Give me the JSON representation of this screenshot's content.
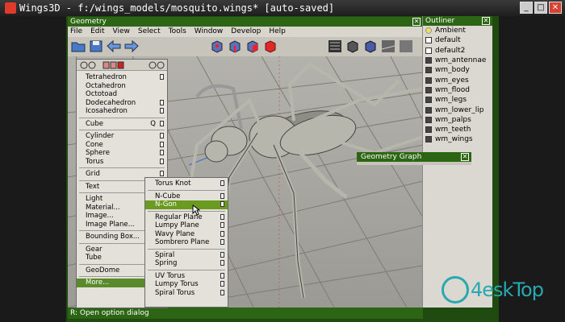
{
  "window": {
    "title": "Wings3D - f:/wings_models/mosquito.wings* [auto-saved]",
    "min": "_",
    "max": "□",
    "close": "✕"
  },
  "geometry": {
    "title": "Geometry",
    "close": "✕"
  },
  "menubar": [
    "File",
    "Edit",
    "View",
    "Select",
    "Tools",
    "Window",
    "Develop",
    "Help"
  ],
  "primitives_menu": {
    "items": [
      {
        "label": "Tetrahedron",
        "opt": true
      },
      {
        "label": "Octahedron",
        "opt": false
      },
      {
        "label": "Octotoad",
        "opt": false
      },
      {
        "label": "Dodecahedron",
        "opt": true
      },
      {
        "label": "Icosahedron",
        "opt": true
      },
      {
        "sep": true
      },
      {
        "label": "Cube",
        "opt": true,
        "key": "Q"
      },
      {
        "sep": true
      },
      {
        "label": "Cylinder",
        "opt": true
      },
      {
        "label": "Cone",
        "opt": true
      },
      {
        "label": "Sphere",
        "opt": true
      },
      {
        "label": "Torus",
        "opt": true
      },
      {
        "sep": true
      },
      {
        "label": "Grid",
        "opt": true
      },
      {
        "sep": true
      },
      {
        "label": "Text",
        "opt": true
      },
      {
        "sep": true
      },
      {
        "label": "Light",
        "opt": false
      },
      {
        "label": "Material...",
        "opt": false
      },
      {
        "label": "Image...",
        "opt": false
      },
      {
        "label": "Image Plane...",
        "opt": false
      },
      {
        "sep": true
      },
      {
        "label": "Bounding Box...",
        "opt": false
      },
      {
        "sep": true
      },
      {
        "label": "Gear",
        "opt": true
      },
      {
        "label": "Tube",
        "opt": true
      },
      {
        "sep": true
      },
      {
        "label": "GeoDome",
        "opt": true
      },
      {
        "sep": true
      },
      {
        "label": "More...",
        "opt": false,
        "hl": true
      }
    ]
  },
  "more_menu": {
    "items": [
      {
        "label": "Torus Knot",
        "opt": true
      },
      {
        "sep": true
      },
      {
        "label": "N-Cube",
        "opt": true
      },
      {
        "label": "N-Gon",
        "opt": true,
        "sel": true
      },
      {
        "sep": true
      },
      {
        "label": "Regular Plane",
        "opt": true
      },
      {
        "label": "Lumpy Plane",
        "opt": true
      },
      {
        "label": "Wavy Plane",
        "opt": true
      },
      {
        "label": "Sombrero Plane",
        "opt": true
      },
      {
        "sep": true
      },
      {
        "label": "Spiral",
        "opt": true
      },
      {
        "label": "Spring",
        "opt": true
      },
      {
        "sep": true
      },
      {
        "label": "UV Torus",
        "opt": true
      },
      {
        "label": "Lumpy Torus",
        "opt": true
      },
      {
        "label": "Spiral Torus",
        "opt": true
      }
    ]
  },
  "outliner": {
    "title": "Outliner",
    "close": "✕",
    "items": [
      {
        "label": "Ambient",
        "type": "light"
      },
      {
        "label": "default",
        "type": "obj"
      },
      {
        "label": "default2",
        "type": "obj"
      },
      {
        "label": "wm_antennae",
        "type": "mat"
      },
      {
        "label": "wm_body",
        "type": "mat"
      },
      {
        "label": "wm_eyes",
        "type": "mat"
      },
      {
        "label": "wm_flood",
        "type": "mat"
      },
      {
        "label": "wm_legs",
        "type": "mat"
      },
      {
        "label": "wm_lower_lip",
        "type": "mat"
      },
      {
        "label": "wm_palps",
        "type": "mat"
      },
      {
        "label": "wm_teeth",
        "type": "mat"
      },
      {
        "label": "wm_wings",
        "type": "mat"
      }
    ]
  },
  "geometry_graph": {
    "title": "Geometry Graph",
    "close": "✕"
  },
  "status": "R: Open option dialog",
  "watermark": "4eskTop"
}
